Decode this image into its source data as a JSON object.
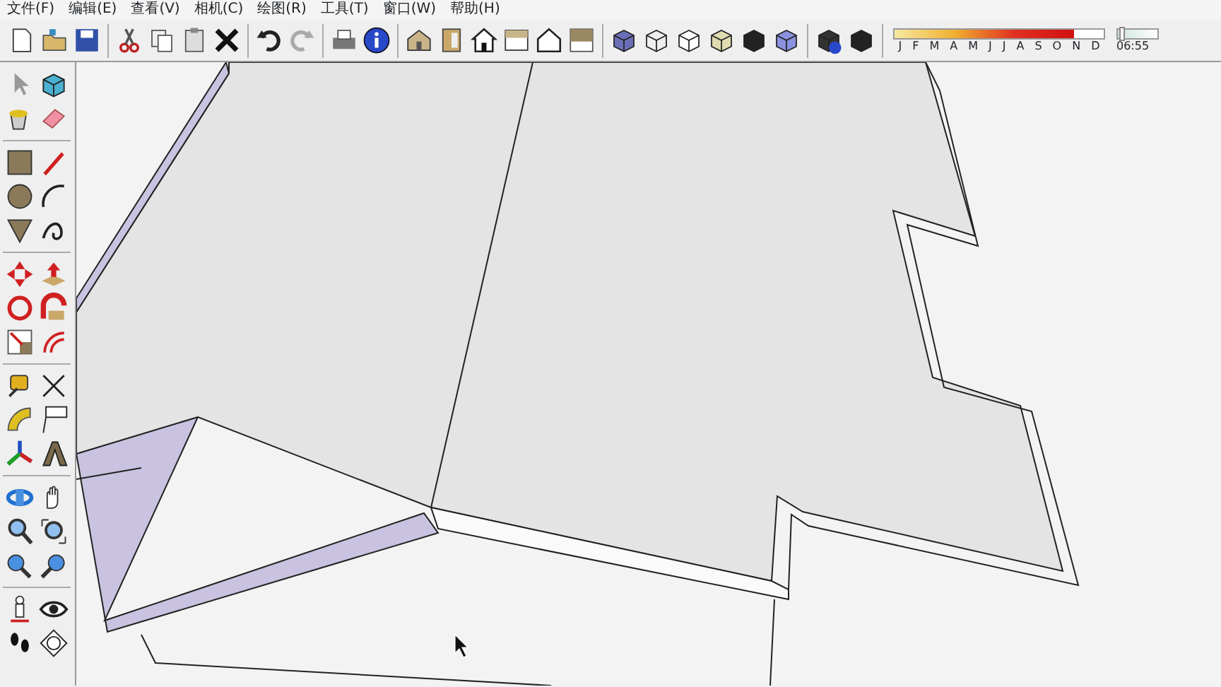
{
  "menu": [
    {
      "label": "文件(F)"
    },
    {
      "label": "编辑(E)"
    },
    {
      "label": "查看(V)"
    },
    {
      "label": "相机(C)"
    },
    {
      "label": "绘图(R)"
    },
    {
      "label": "工具(T)"
    },
    {
      "label": "窗口(W)"
    },
    {
      "label": "帮助(H)"
    }
  ],
  "shadow": {
    "months": [
      "J",
      "F",
      "M",
      "A",
      "M",
      "J",
      "J",
      "A",
      "S",
      "O",
      "N",
      "D"
    ],
    "month_slider": {
      "level": 0.86
    },
    "time": "06:55",
    "time_slider": {
      "level": 0.03
    }
  }
}
